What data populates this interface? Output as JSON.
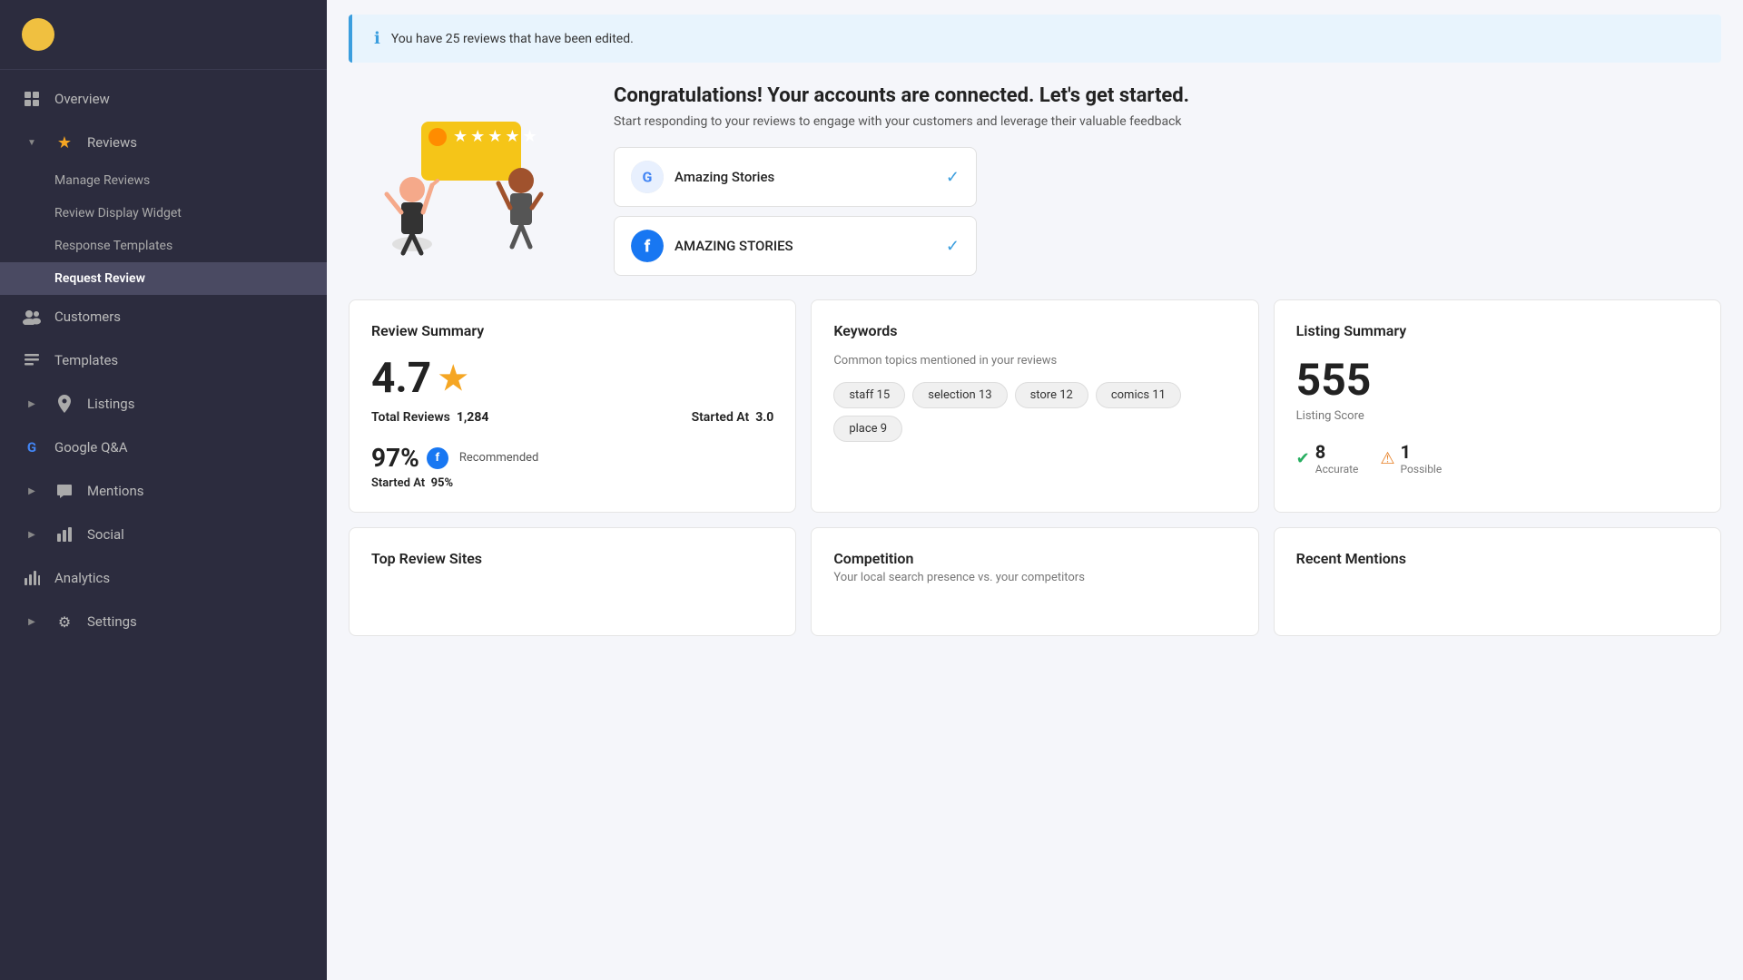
{
  "sidebar": {
    "logo_bg": "#f0c040",
    "items": [
      {
        "id": "overview",
        "label": "Overview",
        "icon": "⊞",
        "type": "item"
      },
      {
        "id": "reviews",
        "label": "Reviews",
        "icon": "★",
        "type": "expandable",
        "expanded": true
      },
      {
        "id": "manage-reviews",
        "label": "Manage Reviews",
        "type": "sub"
      },
      {
        "id": "review-display-widget",
        "label": "Review Display Widget",
        "type": "sub"
      },
      {
        "id": "response-templates",
        "label": "Response Templates",
        "type": "sub"
      },
      {
        "id": "request-review",
        "label": "Request Review",
        "type": "sub",
        "active": true
      },
      {
        "id": "customers",
        "label": "Customers",
        "icon": "👥",
        "type": "item"
      },
      {
        "id": "templates",
        "label": "Templates",
        "icon": "☰",
        "type": "item"
      },
      {
        "id": "listings",
        "label": "Listings",
        "icon": "📍",
        "type": "expandable"
      },
      {
        "id": "google-qa",
        "label": "Google Q&A",
        "icon": "G",
        "type": "item"
      },
      {
        "id": "mentions",
        "label": "Mentions",
        "icon": "💬",
        "type": "expandable"
      },
      {
        "id": "social",
        "label": "Social",
        "icon": "📊",
        "type": "expandable"
      },
      {
        "id": "analytics",
        "label": "Analytics",
        "icon": "📈",
        "type": "item"
      },
      {
        "id": "settings",
        "label": "Settings",
        "icon": "⚙",
        "type": "expandable"
      }
    ]
  },
  "banner": {
    "text": "You have 25 reviews that have been edited."
  },
  "hero": {
    "title": "Congratulations! Your accounts are connected. Let's get started.",
    "subtitle": "Start responding to your reviews to engage with your customers and leverage their valuable feedback",
    "accounts": [
      {
        "id": "amazing-stories-google",
        "name": "Amazing Stories",
        "platform": "google",
        "connected": true
      },
      {
        "id": "amazing-stories-facebook",
        "name": "AMAZING STORIES",
        "platform": "facebook",
        "connected": true
      }
    ]
  },
  "review_summary": {
    "title": "Review Summary",
    "rating": "4.7",
    "star": "★",
    "total_reviews_label": "Total Reviews",
    "total_reviews_value": "1,284",
    "started_at_label": "Started At",
    "started_at_value": "3.0",
    "recommended_pct": "97%",
    "recommended_label": "Recommended",
    "started_at_pct_label": "Started At",
    "started_at_pct_value": "95%"
  },
  "keywords": {
    "title": "Keywords",
    "description": "Common topics mentioned in your reviews",
    "tags": [
      {
        "label": "staff 15"
      },
      {
        "label": "selection 13"
      },
      {
        "label": "store 12"
      },
      {
        "label": "comics 11"
      },
      {
        "label": "place 9"
      }
    ]
  },
  "listing_summary": {
    "title": "Listing Summary",
    "score": "555",
    "score_label": "Listing Score",
    "accurate_count": "8",
    "accurate_label": "Accurate",
    "possible_count": "1",
    "possible_label": "Possible"
  },
  "bottom_cards": [
    {
      "id": "top-review-sites",
      "title": "Top Review Sites"
    },
    {
      "id": "competition",
      "title": "Competition",
      "subtitle": "Your local search presence vs. your competitors"
    },
    {
      "id": "recent-mentions",
      "title": "Recent Mentions"
    }
  ]
}
